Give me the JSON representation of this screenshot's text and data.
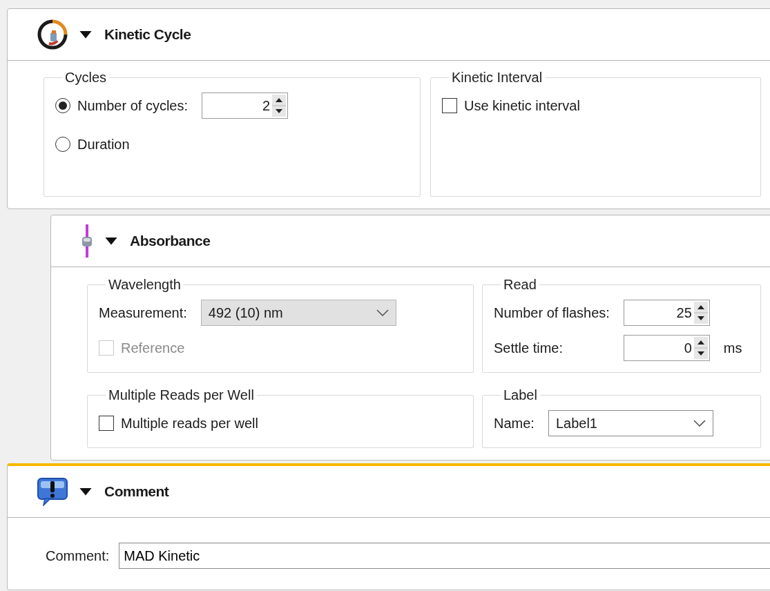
{
  "sections": [
    {
      "kind": "kinetic-cycle",
      "title": "Kinetic Cycle",
      "expanded": true,
      "selected": false,
      "groups": [
        {
          "title": "Cycles",
          "controls": [
            {
              "kind": "radio",
              "label": "Number of cycles:",
              "selected": true,
              "value": "2"
            },
            {
              "kind": "radio",
              "label": "Duration",
              "selected": false
            }
          ]
        },
        {
          "title": "Kinetic Interval",
          "controls": [
            {
              "kind": "checkbox",
              "label": "Use kinetic interval",
              "checked": false,
              "disabled": false
            }
          ]
        }
      ],
      "children": [
        {
          "kind": "absorbance",
          "title": "Absorbance",
          "expanded": true,
          "selected": false,
          "groups": [
            {
              "title": "Wavelength",
              "controls": [
                {
                  "kind": "select",
                  "label": "Measurement:",
                  "value": "492 (10) nm",
                  "editable": false
                },
                {
                  "kind": "checkbox",
                  "label": "Reference",
                  "checked": false,
                  "disabled": true
                }
              ]
            },
            {
              "title": "Read",
              "controls": [
                {
                  "kind": "spin",
                  "label": "Number of flashes:",
                  "value": "25"
                },
                {
                  "kind": "spin",
                  "label": "Settle time:",
                  "value": "0",
                  "unit": "ms"
                }
              ]
            },
            {
              "title": "Multiple Reads per Well",
              "controls": [
                {
                  "kind": "checkbox",
                  "label": "Multiple reads per well",
                  "checked": false,
                  "disabled": false
                }
              ]
            },
            {
              "title": "Label",
              "controls": [
                {
                  "kind": "select",
                  "label": "Name:",
                  "value": "Label1",
                  "editable": true
                }
              ]
            }
          ]
        }
      ]
    },
    {
      "kind": "comment",
      "title": "Comment",
      "expanded": true,
      "selected": true,
      "fields": [
        {
          "kind": "text",
          "label": "Comment:",
          "value": "MAD Kinetic"
        }
      ]
    }
  ]
}
